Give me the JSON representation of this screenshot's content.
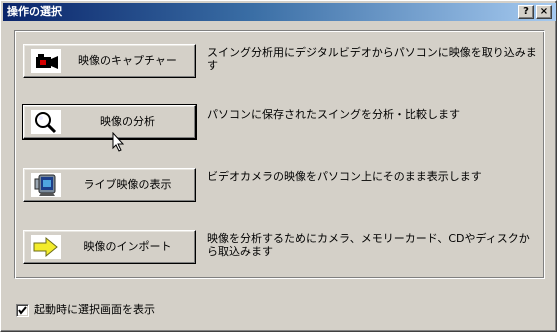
{
  "window": {
    "title": "操作の選択",
    "help_glyph": "?",
    "close_glyph": "×"
  },
  "actions": [
    {
      "label": "映像のキャプチャー",
      "description": "スイング分析用にデジタルビデオからパソコンに映像を取り込みます",
      "icon": "video-camera-icon"
    },
    {
      "label": "映像の分析",
      "description": "パソコンに保存されたスイングを分析・比較します",
      "icon": "magnifier-icon"
    },
    {
      "label": "ライブ映像の表示",
      "description": "ビデオカメラの映像をパソコン上にそのまま表示します",
      "icon": "webcam-icon"
    },
    {
      "label": "映像のインポート",
      "description": "映像を分析するためにカメラ、メモリーカード、CDやディスクから取込みます",
      "icon": "arrow-right-icon"
    }
  ],
  "footer": {
    "checkbox_label": "起動時に選択画面を表示",
    "checked": true
  },
  "colors": {
    "title_gradient_start": "#0a246a",
    "title_gradient_end": "#a6caf0",
    "face": "#d4d0c8"
  }
}
